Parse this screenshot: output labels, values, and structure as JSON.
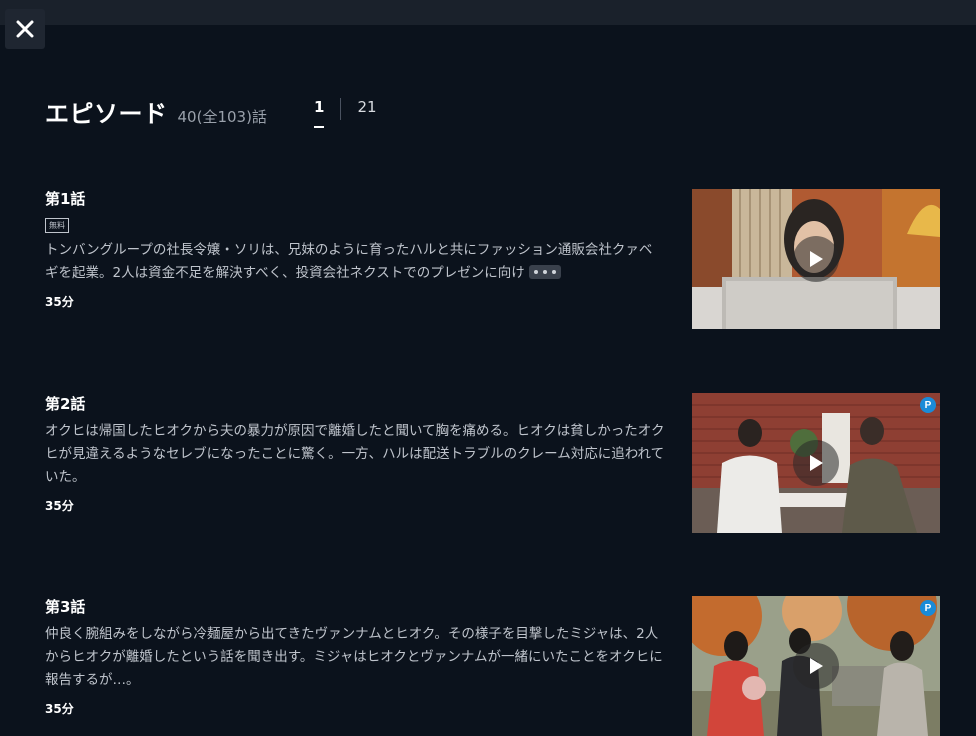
{
  "header": {
    "title": "エピソード",
    "count": "40(全103)話"
  },
  "pagination": {
    "tabs": [
      "1",
      "21"
    ],
    "active": "1"
  },
  "episodes": [
    {
      "title": "第1話",
      "badge": "無料",
      "description": "トンバングループの社長令嬢・ソリは、兄妹のように育ったハルと共にファッション通販会社クァベギを起業。2人は資金不足を解決すべく、投資会社ネクストでのプレゼンに向け",
      "duration": "35分",
      "has_more": true,
      "premium": false
    },
    {
      "title": "第2話",
      "badge": "",
      "description": "オクヒは帰国したヒオクから夫の暴力が原因で離婚したと聞いて胸を痛める。ヒオクは貧しかったオクヒが見違えるようなセレブになったことに驚く。一方、ハルは配送トラブルのクレーム対応に追われていた。",
      "duration": "35分",
      "has_more": false,
      "premium": true,
      "premium_label": "P"
    },
    {
      "title": "第3話",
      "badge": "",
      "description": "仲良く腕組みをしながら冷麺屋から出てきたヴァンナムとヒオク。その様子を目撃したミジャは、2人からヒオクが離婚したという話を聞き出す。ミジャはヒオクとヴァンナムが一緒にいたことをオクヒに報告するが…。",
      "duration": "35分",
      "has_more": false,
      "premium": true,
      "premium_label": "P"
    }
  ],
  "icons": {
    "close": "close-icon",
    "play": "play-icon",
    "more": "more-dots-icon"
  },
  "colors": {
    "background": "#0b121c",
    "accent_badge": "#1a8bd8"
  }
}
